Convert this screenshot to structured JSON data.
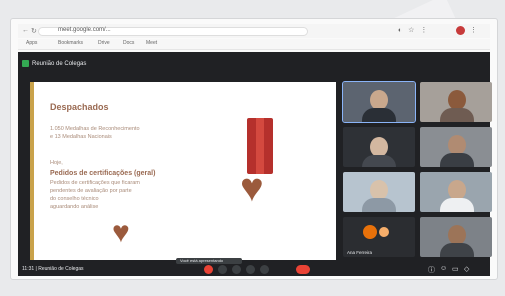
{
  "browser": {
    "address": "meet.google.com/...",
    "bookmarks": [
      "Apps",
      "Bookmarks",
      "Drive",
      "Docs",
      "Meet"
    ]
  },
  "meeting": {
    "title": "Reunião de Colegas",
    "info": "11:31 | Reunião de Colegas"
  },
  "slide": {
    "heading": "Despachados",
    "lines": [
      "1.050 Medalhas de Reconhecimento",
      "e 13 Medalhas Nacionais"
    ],
    "intro": "Hoje,",
    "subheading": "Pedidos de certificações (geral)",
    "body": [
      "Pedidos de certificações que ficaram",
      "pendentes de avaliação por parte",
      "do conselho técnico",
      "aguardando análise"
    ]
  },
  "participants": [
    {
      "name": "",
      "active": true
    },
    {
      "name": ""
    },
    {
      "name": ""
    },
    {
      "name": ""
    },
    {
      "name": ""
    },
    {
      "name": ""
    },
    {
      "name": "Ana Ferreira"
    },
    {
      "name": ""
    }
  ],
  "colors": {
    "ribbon": "#b5302c",
    "heart": "#9b5a3c",
    "accent": "#c9a24a",
    "end_call": "#ea4335"
  },
  "presenting_label": "Você está apresentando"
}
